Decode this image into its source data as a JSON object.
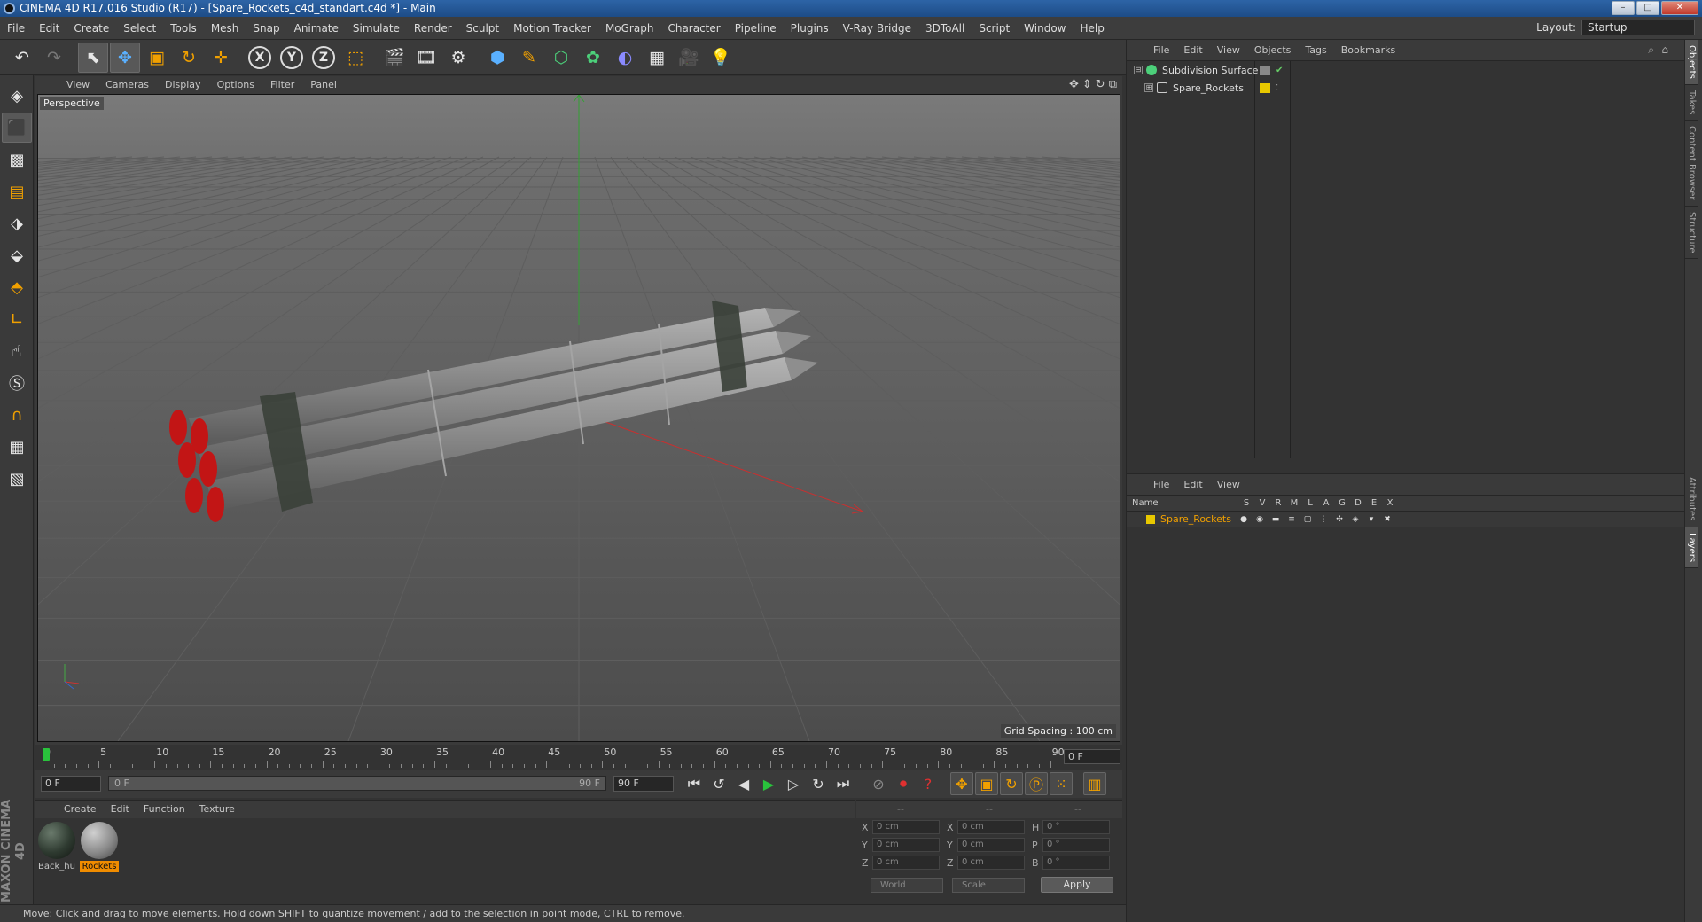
{
  "window": {
    "title": "CINEMA 4D R17.016 Studio (R17) - [Spare_Rockets_c4d_standart.c4d *] - Main",
    "minimize": "–",
    "maximize": "□",
    "close": "✕"
  },
  "menubar": {
    "items": [
      "File",
      "Edit",
      "Create",
      "Select",
      "Tools",
      "Mesh",
      "Snap",
      "Animate",
      "Simulate",
      "Render",
      "Sculpt",
      "Motion Tracker",
      "MoGraph",
      "Character",
      "Pipeline",
      "Plugins",
      "V-Ray Bridge",
      "3DToAll",
      "Script",
      "Window",
      "Help"
    ],
    "layout_label": "Layout:",
    "layout_value": "Startup"
  },
  "viewport": {
    "menu": [
      "View",
      "Cameras",
      "Display",
      "Options",
      "Filter",
      "Panel"
    ],
    "camera_label": "Perspective",
    "grid_spacing": "Grid Spacing : 100 cm"
  },
  "timeline": {
    "ticks": [
      "0",
      "5",
      "10",
      "15",
      "20",
      "25",
      "30",
      "35",
      "40",
      "45",
      "50",
      "55",
      "60",
      "65",
      "70",
      "75",
      "80",
      "85",
      "90"
    ],
    "current_frame": "0 F"
  },
  "transport": {
    "start": "0 F",
    "range_start": "0 F",
    "range_end": "90 F",
    "end": "90 F"
  },
  "materials": {
    "menu": [
      "Create",
      "Edit",
      "Function",
      "Texture"
    ],
    "items": [
      {
        "name": "Back_hu",
        "color": "#2e3a30",
        "selected": false
      },
      {
        "name": "Rockets",
        "color": "#8a8a8a",
        "selected": true
      }
    ]
  },
  "coords": {
    "header": [
      "--",
      "--",
      "--"
    ],
    "rows": [
      {
        "a": "X",
        "v1": "0 cm",
        "b": "X",
        "v2": "0 cm",
        "c": "H",
        "v3": "0 °"
      },
      {
        "a": "Y",
        "v1": "0 cm",
        "b": "Y",
        "v2": "0 cm",
        "c": "P",
        "v3": "0 °"
      },
      {
        "a": "Z",
        "v1": "0 cm",
        "b": "Z",
        "v2": "0 cm",
        "c": "B",
        "v3": "0 °"
      }
    ],
    "world": "World",
    "scale": "Scale",
    "apply": "Apply"
  },
  "status": "Move: Click and drag to move elements. Hold down SHIFT to quantize movement / add to the selection in point mode, CTRL to remove.",
  "objects": {
    "menu": [
      "File",
      "Edit",
      "View",
      "Objects",
      "Tags",
      "Bookmarks"
    ],
    "items": [
      {
        "name": "Subdivision Surface",
        "expand": "⊟"
      },
      {
        "name": "Spare_Rockets",
        "expand": "⊞"
      }
    ]
  },
  "layers": {
    "menu": [
      "File",
      "Edit",
      "View"
    ],
    "name_col": "Name",
    "cols": [
      "S",
      "V",
      "R",
      "M",
      "L",
      "A",
      "G",
      "D",
      "E",
      "X"
    ],
    "items": [
      {
        "name": "Spare_Rockets",
        "color": "#e8c800"
      }
    ]
  },
  "sidetabs": [
    "Objects",
    "Takes",
    "Content Browser",
    "Structure",
    "Attributes",
    "Layers"
  ],
  "maxon": "MAXON CINEMA 4D",
  "colors": {
    "accent": "#f08c00",
    "play": "#29c33c",
    "axis_x": "#d03030",
    "axis_y": "#30a030"
  }
}
